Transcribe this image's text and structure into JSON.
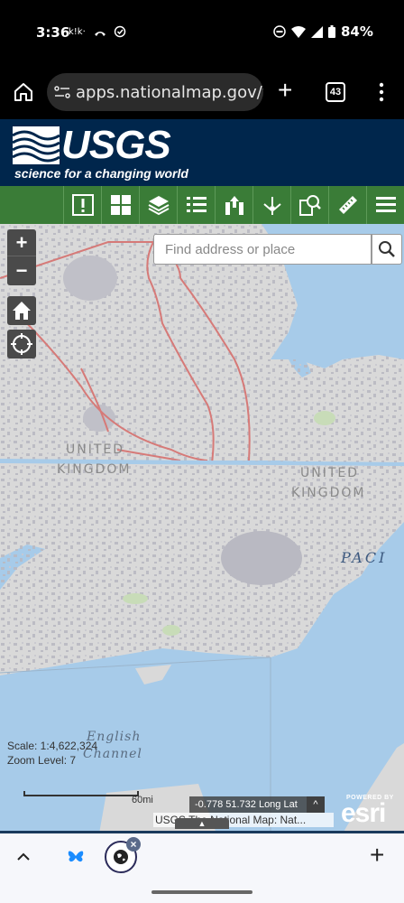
{
  "status_bar": {
    "time": "3:36",
    "left_icons": "k!k·",
    "battery": "84%"
  },
  "browser": {
    "url": "apps.nationalmap.gov/viev",
    "tab_count": "43",
    "new_tab": "+"
  },
  "header": {
    "logo": "USGS",
    "tagline": "science for a changing world"
  },
  "toolbar": {
    "buttons": [
      "alert-icon",
      "grid-icon",
      "layers-icon",
      "list-icon",
      "upload-icon",
      "share-icon",
      "search-map-icon",
      "measure-icon",
      "menu-icon"
    ],
    "alert_label": "!"
  },
  "map": {
    "search_placeholder": "Find address or place",
    "zoom_in": "+",
    "zoom_out": "−",
    "labels": {
      "uk_west_1": "UNITED",
      "uk_west_2": "KINGDOM",
      "uk_east_1": "UNITED",
      "uk_east_2": "KINGDOM",
      "ocean": "PACI",
      "sea_1": "English",
      "sea_2": "Channel"
    },
    "scale": "Scale: 1:4,622,324",
    "zoom_level": "Zoom Level: 7",
    "scale_bar_label": "60mi",
    "coordinates": "-0.778 51.732 Long Lat",
    "coord_caret": "^",
    "attribution": "USGS The National Map: Nat...",
    "attribution_toggle": "▲",
    "esri_powered": "POWERED BY",
    "esri": "esri",
    "colors": {
      "land": "#d9d9d9",
      "water": "#a7cbe9",
      "urban": "#b9b9c2",
      "road": "#d67a78"
    }
  },
  "bottom_bar": {
    "plus": "+",
    "tab_close": "×"
  }
}
